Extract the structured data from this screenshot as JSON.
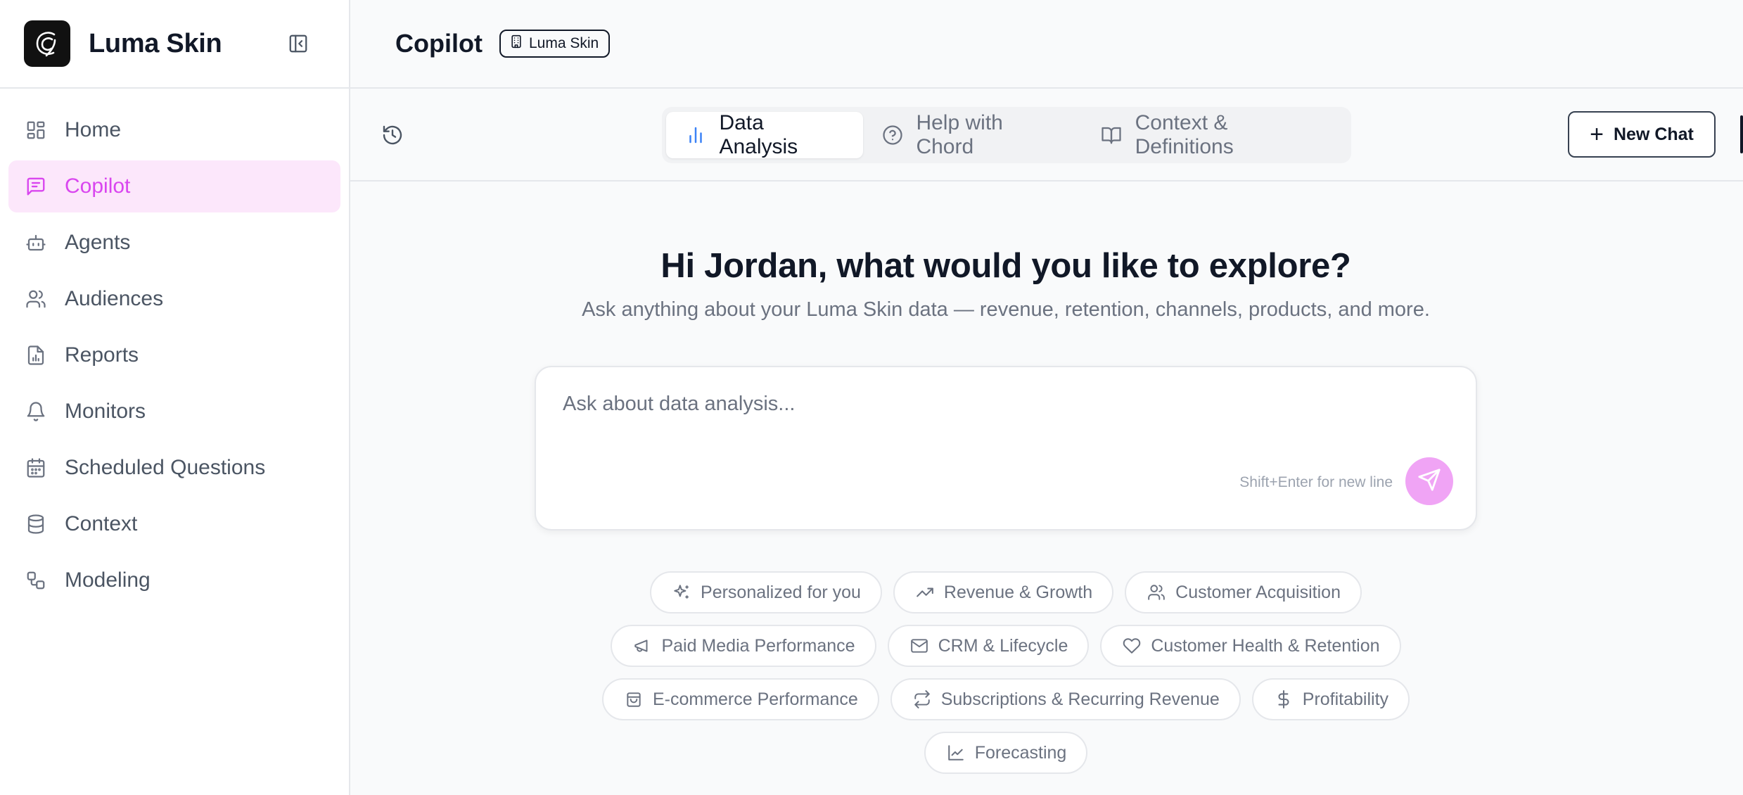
{
  "brand": {
    "name": "Luma Skin"
  },
  "sidebar": {
    "items": [
      {
        "label": "Home",
        "icon": "dashboard-icon",
        "active": false
      },
      {
        "label": "Copilot",
        "icon": "message-square-icon",
        "active": true
      },
      {
        "label": "Agents",
        "icon": "bot-icon",
        "active": false
      },
      {
        "label": "Audiences",
        "icon": "users-icon",
        "active": false
      },
      {
        "label": "Reports",
        "icon": "file-chart-icon",
        "active": false
      },
      {
        "label": "Monitors",
        "icon": "bell-icon",
        "active": false
      },
      {
        "label": "Scheduled Questions",
        "icon": "calendar-icon",
        "active": false
      },
      {
        "label": "Context",
        "icon": "database-icon",
        "active": false
      },
      {
        "label": "Modeling",
        "icon": "workflow-icon",
        "active": false
      }
    ]
  },
  "header": {
    "title": "Copilot",
    "workspace_badge": "Luma Skin"
  },
  "tabs": [
    {
      "label": "Data Analysis",
      "icon": "bar-chart-icon",
      "active": true
    },
    {
      "label": "Help with Chord",
      "icon": "help-circle-icon",
      "active": false
    },
    {
      "label": "Context & Definitions",
      "icon": "book-open-icon",
      "active": false
    }
  ],
  "toolbar": {
    "new_chat_label": "New Chat"
  },
  "main": {
    "greeting": "Hi Jordan, what would you like to explore?",
    "subtitle": "Ask anything about your Luma Skin data — revenue, retention, channels, products, and more.",
    "input_placeholder": "Ask about data analysis...",
    "input_value": "",
    "hint": "Shift+Enter for new line"
  },
  "chips": [
    [
      {
        "label": "Personalized for you",
        "icon": "sparkles-icon"
      },
      {
        "label": "Revenue & Growth",
        "icon": "trending-up-icon"
      },
      {
        "label": "Customer Acquisition",
        "icon": "users-icon"
      }
    ],
    [
      {
        "label": "Paid Media Performance",
        "icon": "megaphone-icon"
      },
      {
        "label": "CRM & Lifecycle",
        "icon": "mail-icon"
      },
      {
        "label": "Customer Health & Retention",
        "icon": "heart-icon"
      }
    ],
    [
      {
        "label": "E-commerce Performance",
        "icon": "shopping-bag-icon"
      },
      {
        "label": "Subscriptions & Recurring Revenue",
        "icon": "repeat-icon"
      },
      {
        "label": "Profitability",
        "icon": "dollar-icon"
      }
    ],
    [
      {
        "label": "Forecasting",
        "icon": "line-chart-icon"
      }
    ]
  ],
  "colors": {
    "accent": "#d946ef",
    "accent_bg": "#fce7fb",
    "send_button": "#f0a4f5",
    "data_tab_icon": "#3b82f6",
    "text_primary": "#111827",
    "text_muted": "#6b7280"
  }
}
